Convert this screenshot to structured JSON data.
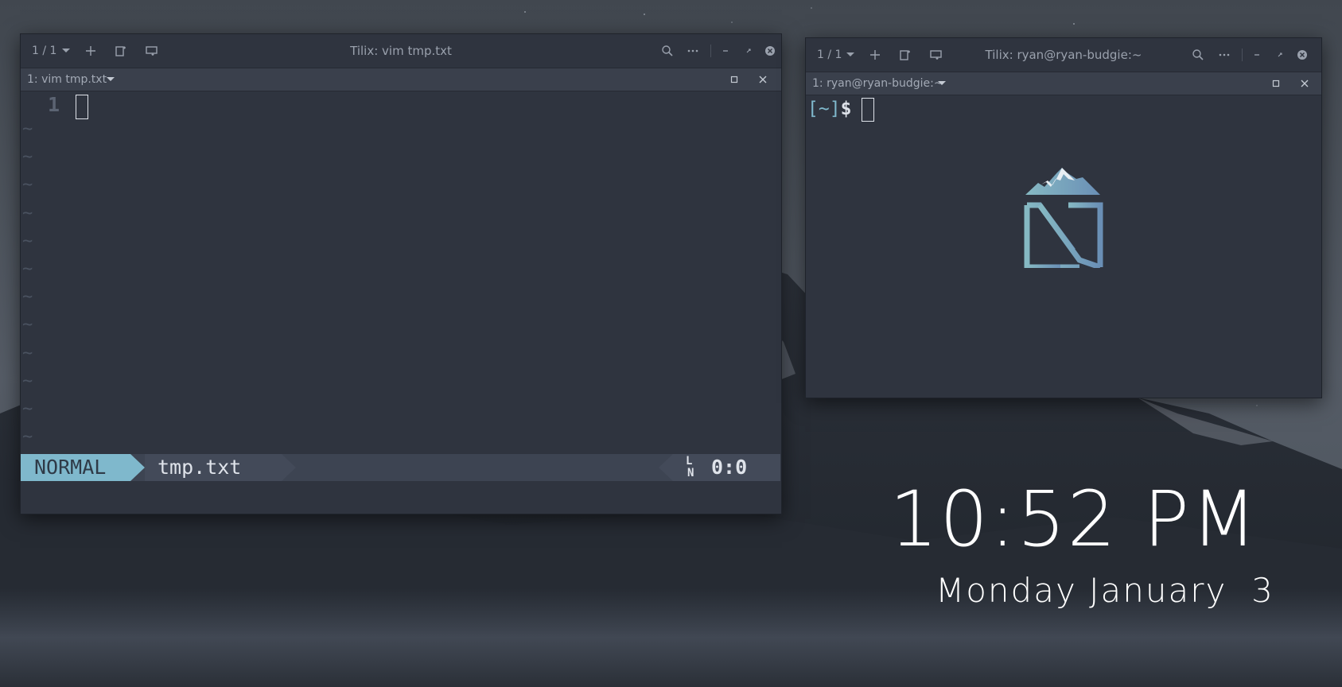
{
  "vim_window": {
    "session_label": "1 / 1",
    "title": "Tilix: vim tmp.txt",
    "terminal_tab_label": "1: vim tmp.txt",
    "line_number": "1",
    "tilde_char": "~",
    "tilde_count": 12,
    "statusline": {
      "mode": "NORMAL",
      "filename": "tmp.txt",
      "ln_top": "L",
      "ln_bottom": "N",
      "position": "0:0"
    }
  },
  "shell_window": {
    "session_label": "1 / 1",
    "title": "Tilix: ryan@ryan-budgie:~",
    "terminal_tab_label": "1: ryan@ryan-budgie:~",
    "prompt_open": "[",
    "prompt_dir": "~",
    "prompt_close": "]",
    "prompt_symbol": "$"
  },
  "desktop": {
    "time": "10:52 PM",
    "date": "Monday January  3"
  },
  "icons": {
    "session_dropdown": "chevron-down-icon",
    "add": "plus-icon",
    "add_right": "split-right-icon",
    "add_down": "split-down-icon",
    "search": "search-icon",
    "menu": "more-icon",
    "minimize": "minimize-icon",
    "maximize": "maximize-icon",
    "close": "close-icon",
    "terminal_maximize": "square-icon",
    "terminal_close": "x-icon",
    "logo": "mountain-logo-icon"
  },
  "colors": {
    "window_bg": "#2f343f",
    "vim_mode_bg": "#7fb8cc",
    "vim_mode_fg": "#2f3a47",
    "statusline_bg": "#3d4452",
    "text_light": "#dfe3ea",
    "prompt_accent": "#7fb8cc",
    "tilde": "#4a5260"
  }
}
